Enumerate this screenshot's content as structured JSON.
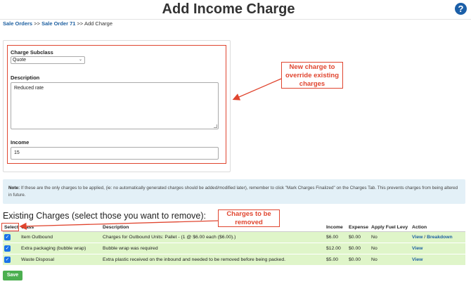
{
  "page": {
    "title": "Add Income Charge",
    "help_icon": "question-circle-icon"
  },
  "breadcrumb": {
    "items": [
      "Sale Orders",
      "Sale Order 71"
    ],
    "separator": ">>",
    "current": "Add Charge"
  },
  "form": {
    "subclass_label": "Charge Subclass",
    "subclass_value": "Quote",
    "description_label": "Description",
    "description_value": "Reduced rate",
    "income_label": "Income",
    "income_value": "15"
  },
  "annotations": {
    "callout_1": [
      "New charge to",
      "override existing",
      "charges"
    ],
    "callout_2": [
      "Charges to be",
      "removed"
    ],
    "accent_color": "#e0452f"
  },
  "note": {
    "label": "Note:",
    "text": "If these are the only charges to be applied, (ie: no automatically generated charges should be added/modified later), remember to click \"Mark Charges Finalized\" on the Charges Tab. This prevents charges from being altered in future."
  },
  "existing_charges": {
    "heading": "Existing Charges (select those you want to remove):",
    "columns": [
      "Select",
      "Class",
      "Description",
      "Income",
      "Expense",
      "Apply Fuel Levy",
      "Action"
    ],
    "rows": [
      {
        "checked": true,
        "class": "Item Outbound",
        "description": "Charges for Outbound Units: Pallet - (1 @ $6.00 each ($6.00).)",
        "income": "$6.00",
        "expense": "$0.00",
        "fuel_levy": "No",
        "action_view": "View",
        "action_sep": "/",
        "action_breakdown": "Breakdown"
      },
      {
        "checked": true,
        "class": "Extra packaging (bubble wrap)",
        "description": "Bubble wrap was required",
        "income": "$12.00",
        "expense": "$0.00",
        "fuel_levy": "No",
        "action_view": "View",
        "action_sep": "",
        "action_breakdown": ""
      },
      {
        "checked": true,
        "class": "Waste Disposal",
        "description": "Extra plastic received on the inbound and needed to be removed before being packed.",
        "income": "$5.00",
        "expense": "$0.00",
        "fuel_levy": "No",
        "action_view": "View",
        "action_sep": "",
        "action_breakdown": ""
      }
    ],
    "row_color": "#dff5c9"
  },
  "save_label": "Save"
}
